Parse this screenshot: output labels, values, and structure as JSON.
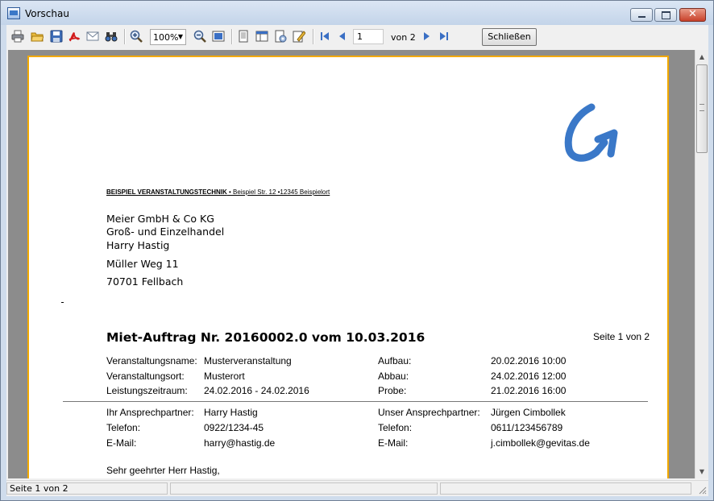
{
  "window": {
    "title": "Vorschau"
  },
  "toolbar": {
    "zoom_value": "100%",
    "page_input": "1",
    "page_of": "von 2",
    "close_label": "Schließen"
  },
  "document": {
    "sender_bold": "BEISPIEL VERANSTALTUNGSTECHNIK",
    "sender_rest": " • Beispiel Str. 12 •12345 Beispielort",
    "recipient": {
      "line1": "Meier GmbH & Co KG",
      "line2": "Groß- und Einzelhandel",
      "line3": "Harry Hastig",
      "street": "Müller Weg 11",
      "city": "70701 Fellbach"
    },
    "title": "Miet-Auftrag Nr. 20160002.0 vom 10.03.2016",
    "page_info": "Seite 1 von 2",
    "details_left": [
      {
        "label": "Veranstaltungsname:",
        "value": "Musterveranstaltung"
      },
      {
        "label": "Veranstaltungsort:",
        "value": "Musterort"
      },
      {
        "label": "Leistungszeitraum:",
        "value": "24.02.2016 - 24.02.2016"
      }
    ],
    "details_right": [
      {
        "label": "Aufbau:",
        "value": "20.02.2016 10:00"
      },
      {
        "label": "Abbau:",
        "value": "24.02.2016 12:00"
      },
      {
        "label": "Probe:",
        "value": "21.02.2016 16:00"
      }
    ],
    "contact_left": [
      {
        "label": "Ihr Ansprechpartner:",
        "value": "Harry Hastig"
      },
      {
        "label": "Telefon:",
        "value": "0922/1234-45"
      },
      {
        "label": "E-Mail:",
        "value": "harry@hastig.de"
      }
    ],
    "contact_right": [
      {
        "label": "Unser Ansprechpartner:",
        "value": "Jürgen Cimbollek"
      },
      {
        "label": "Telefon:",
        "value": "0611/123456789"
      },
      {
        "label": "E-Mail:",
        "value": "j.cimbollek@gevitas.de"
      }
    ],
    "greeting": "Sehr geehrter Herr Hastig,"
  },
  "statusbar": {
    "page": "Seite 1 von 2"
  },
  "icons": [
    "print-icon",
    "open-folder-icon",
    "save-icon",
    "pdf-icon",
    "email-icon",
    "find-icon",
    "zoom-in-icon",
    "zoom-out-icon",
    "fit-page-icon",
    "single-page-icon",
    "two-page-icon",
    "page-setup-icon",
    "edit-icon",
    "first-page-icon",
    "previous-page-icon",
    "next-page-icon",
    "last-page-icon"
  ],
  "colors": {
    "page_border": "#f2a900",
    "logo": "#3a78c8",
    "nav_arrows": "#3a6fc4"
  }
}
